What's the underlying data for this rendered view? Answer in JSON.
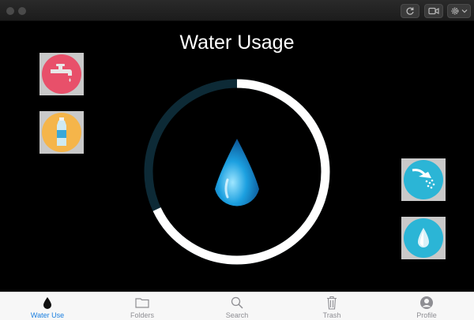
{
  "window": {
    "toolbar_icons": [
      "refresh-icon",
      "video-icon",
      "gear-icon"
    ]
  },
  "main": {
    "title": "Water Usage",
    "left_tiles": [
      {
        "icon": "faucet-icon",
        "color": "#e8506a"
      },
      {
        "icon": "water-bottle-icon",
        "color": "#f5b54a"
      }
    ],
    "right_tiles": [
      {
        "icon": "shower-icon",
        "color": "#2bb5d6"
      },
      {
        "icon": "water-drop-icon",
        "color": "#2bb5d6"
      }
    ],
    "gauge": {
      "fill_fraction": 0.68,
      "fill_color": "#ffffff",
      "track_color": "#0d2a36",
      "center_icon": "water-drop-icon"
    }
  },
  "tabbar": {
    "tabs": [
      {
        "label": "Water Use",
        "icon": "water-drop-icon",
        "active": true
      },
      {
        "label": "Folders",
        "icon": "folder-icon",
        "active": false
      },
      {
        "label": "Search",
        "icon": "search-icon",
        "active": false
      },
      {
        "label": "Trash",
        "icon": "trash-icon",
        "active": false
      },
      {
        "label": "Profile",
        "icon": "profile-icon",
        "active": false
      }
    ],
    "active_color": "#1a7fe0"
  }
}
